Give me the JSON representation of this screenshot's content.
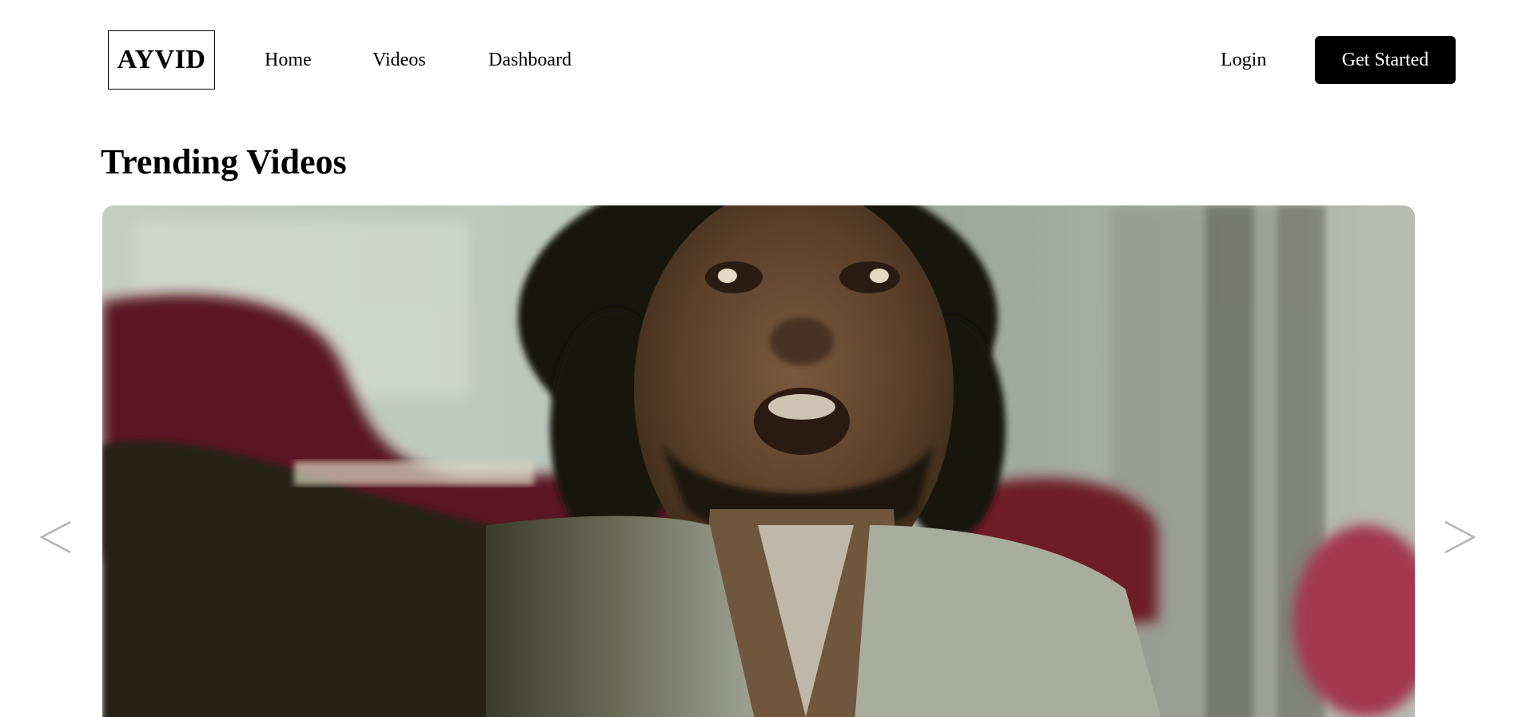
{
  "brand": {
    "logo_text": "AYVID"
  },
  "nav": {
    "home": "Home",
    "videos": "Videos",
    "dashboard": "Dashboard",
    "login": "Login",
    "get_started": "Get Started"
  },
  "trending": {
    "title": "Trending Videos",
    "prev_icon": "chevron-left-icon",
    "next_icon": "chevron-right-icon"
  },
  "colors": {
    "primary_button_bg": "#000000",
    "primary_button_text": "#ffffff",
    "arrow": "#b3b3b3"
  }
}
